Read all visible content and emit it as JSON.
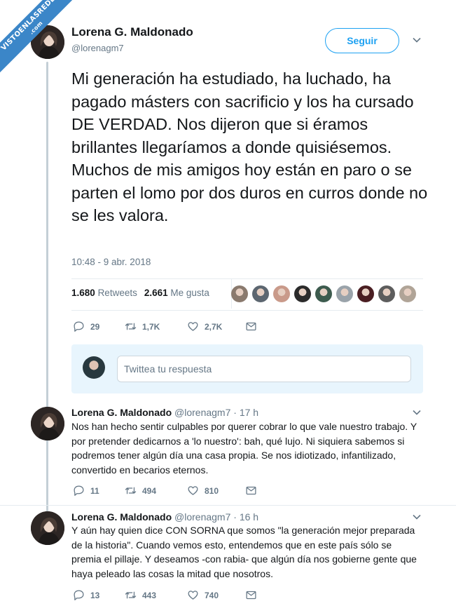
{
  "watermark": {
    "line1": "VISTOENLASREDES",
    "line2": ".com"
  },
  "main_tweet": {
    "author_name": "Lorena G. Maldonado",
    "author_handle": "@lorenagm7",
    "follow_label": "Seguir",
    "text": "Mi generación ha estudiado, ha luchado, ha pagado másters con sacrificio y los ha cursado DE VERDAD. Nos dijeron que si éramos brillantes llegaríamos a donde quisiésemos. Muchos de mis amigos hoy están en paro o se parten el lomo por dos duros en curros donde no se les valora.",
    "timestamp": "10:48 - 9 abr. 2018",
    "retweets_count": "1.680",
    "retweets_label": "Retweets",
    "likes_count": "2.661",
    "likes_label": "Me gusta",
    "replies": "29",
    "retweets": "1,7K",
    "likes": "2,7K"
  },
  "liker_colors": [
    "#8a7a6e",
    "#5c6670",
    "#c99a8a",
    "#2b2b2b",
    "#3d5b4e",
    "#9aa3aa",
    "#4a1e22",
    "#5d5d5d",
    "#b0a497"
  ],
  "reply_box": {
    "placeholder": "Twittea tu respuesta"
  },
  "replies": [
    {
      "author_name": "Lorena G. Maldonado",
      "meta": "@lorenagm7 · 17 h",
      "text": "Nos han hecho sentir culpables por querer cobrar lo que vale nuestro trabajo. Y por pretender dedicarnos a 'lo nuestro': bah, qué lujo. Ni siquiera sabemos si podremos tener algún día una casa propia. Se nos idiotizado, infantilizado, convertido en becarios eternos.",
      "replies": "11",
      "retweets": "494",
      "likes": "810"
    },
    {
      "author_name": "Lorena G. Maldonado",
      "meta": "@lorenagm7 · 16 h",
      "text": "Y aún hay quien dice CON SORNA que somos \"la generación mejor preparada de la historia\". Cuando vemos esto, entendemos que en este país sólo se premia el pillaje. Y deseamos -con rabia- que algún día nos gobierne gente que haya peleado las cosas la mitad que nosotros.",
      "replies": "13",
      "retweets": "443",
      "likes": "740"
    }
  ],
  "colors": {
    "accent": "#1da1f2",
    "muted": "#657786",
    "text": "#14171a",
    "reply_bg": "#e8f5fd"
  }
}
